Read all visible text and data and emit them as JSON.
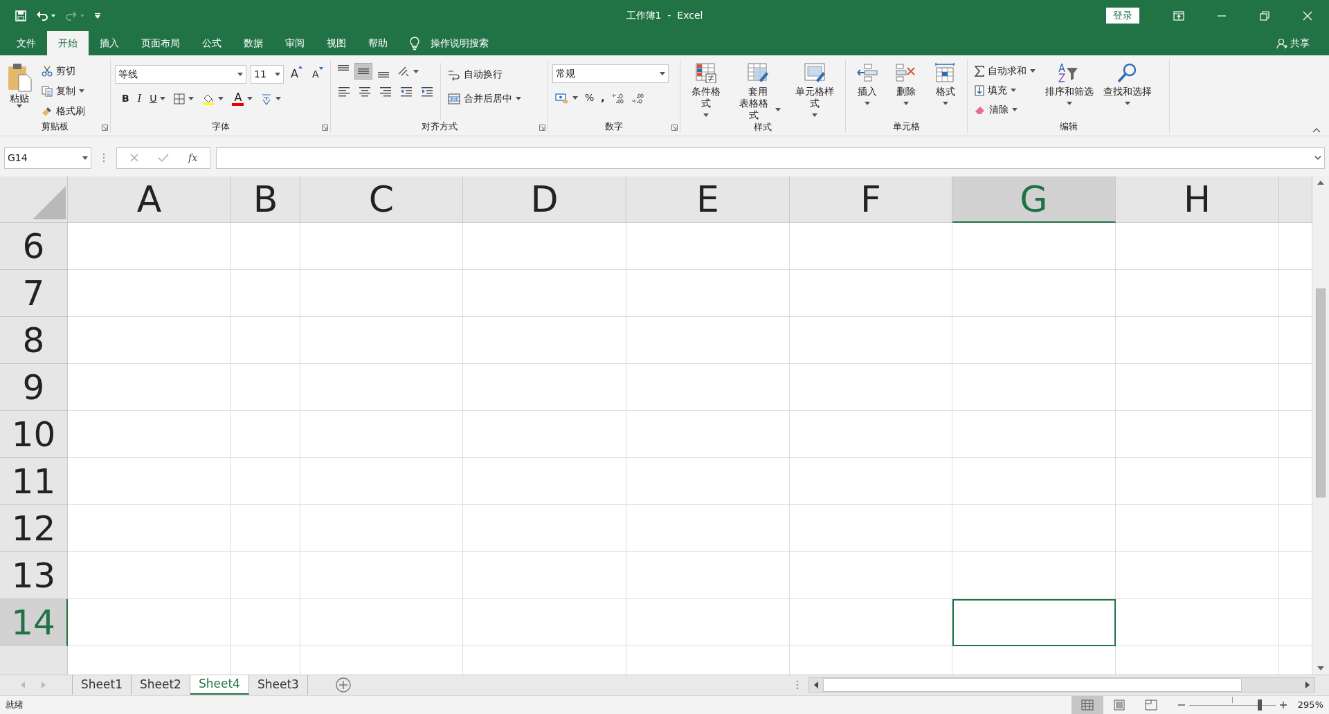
{
  "window": {
    "title": "工作簿1  -  Excel",
    "sign_in": "登录",
    "share": "共享"
  },
  "quick_access": [
    {
      "kind": "save",
      "disabled": false
    },
    {
      "kind": "undo",
      "disabled": false
    },
    {
      "kind": "redo",
      "disabled": true
    },
    {
      "kind": "customize",
      "disabled": false
    }
  ],
  "tabs": [
    {
      "label": "文件",
      "selected": false
    },
    {
      "label": "开始",
      "selected": true
    },
    {
      "label": "插入",
      "selected": false
    },
    {
      "label": "页面布局",
      "selected": false
    },
    {
      "label": "公式",
      "selected": false
    },
    {
      "label": "数据",
      "selected": false
    },
    {
      "label": "审阅",
      "selected": false
    },
    {
      "label": "视图",
      "selected": false
    },
    {
      "label": "帮助",
      "selected": false
    }
  ],
  "tell_me": "操作说明搜索",
  "ribbon": {
    "clipboard": {
      "label": "剪贴板",
      "paste": "粘贴",
      "items": [
        {
          "kind": "cut",
          "label": "剪切",
          "dropdown": false
        },
        {
          "kind": "copy",
          "label": "复制",
          "dropdown": true
        },
        {
          "kind": "painter",
          "label": "格式刷",
          "dropdown": false
        }
      ]
    },
    "font": {
      "label": "字体",
      "font_name": "等线",
      "font_size": "11",
      "grow": "A",
      "shrink": "A",
      "bold": "B",
      "italic": "I",
      "underline": "U",
      "font_color": "A"
    },
    "alignment": {
      "label": "对齐方式",
      "vertical": [
        {
          "kind": "top",
          "selected": false
        },
        {
          "kind": "middle",
          "selected": true
        },
        {
          "kind": "bottom",
          "selected": false
        }
      ],
      "wrap": "自动换行",
      "merge": "合并后居中"
    },
    "number": {
      "label": "数字",
      "format": "常规",
      "percent": "%",
      "comma": ","
    },
    "styles": {
      "label": "样式",
      "items": [
        {
          "kind": "conditional",
          "lines": [
            "条件格式"
          ]
        },
        {
          "kind": "table",
          "lines": [
            "套用",
            "表格格式"
          ]
        },
        {
          "kind": "cellstyle",
          "lines": [
            "单元格样式"
          ]
        }
      ]
    },
    "cells": {
      "label": "单元格",
      "items": [
        {
          "kind": "insert",
          "label": "插入"
        },
        {
          "kind": "delete",
          "label": "删除"
        },
        {
          "kind": "format",
          "label": "格式"
        }
      ]
    },
    "editing": {
      "label": "编辑",
      "small": [
        {
          "kind": "sum",
          "label": "自动求和"
        },
        {
          "kind": "fill",
          "label": "填充"
        },
        {
          "kind": "clear",
          "label": "清除"
        }
      ],
      "large": [
        {
          "kind": "sort",
          "label": "排序和筛选"
        },
        {
          "kind": "find",
          "label": "查找和选择"
        }
      ]
    }
  },
  "name_box": "G14",
  "function_label": "fx",
  "columns": [
    {
      "label": "A",
      "selected": false
    },
    {
      "label": "B",
      "selected": false
    },
    {
      "label": "C",
      "selected": false
    },
    {
      "label": "D",
      "selected": false
    },
    {
      "label": "E",
      "selected": false
    },
    {
      "label": "F",
      "selected": false
    },
    {
      "label": "G",
      "selected": true
    },
    {
      "label": "H",
      "selected": false
    }
  ],
  "rows": [
    {
      "label": "6",
      "selected": false
    },
    {
      "label": "7",
      "selected": false
    },
    {
      "label": "8",
      "selected": false
    },
    {
      "label": "9",
      "selected": false
    },
    {
      "label": "10",
      "selected": false
    },
    {
      "label": "11",
      "selected": false
    },
    {
      "label": "12",
      "selected": false
    },
    {
      "label": "13",
      "selected": false
    },
    {
      "label": "14",
      "selected": true
    }
  ],
  "sheets": [
    {
      "label": "Sheet1",
      "selected": false
    },
    {
      "label": "Sheet2",
      "selected": false
    },
    {
      "label": "Sheet4",
      "selected": true
    },
    {
      "label": "Sheet3",
      "selected": false
    }
  ],
  "status_bar": {
    "status": "就绪",
    "views": [
      {
        "kind": "normal",
        "selected": true
      },
      {
        "kind": "page_layout",
        "selected": false
      },
      {
        "kind": "page_break",
        "selected": false
      }
    ],
    "zoom": {
      "level": 0.82,
      "reading": "295%"
    }
  }
}
